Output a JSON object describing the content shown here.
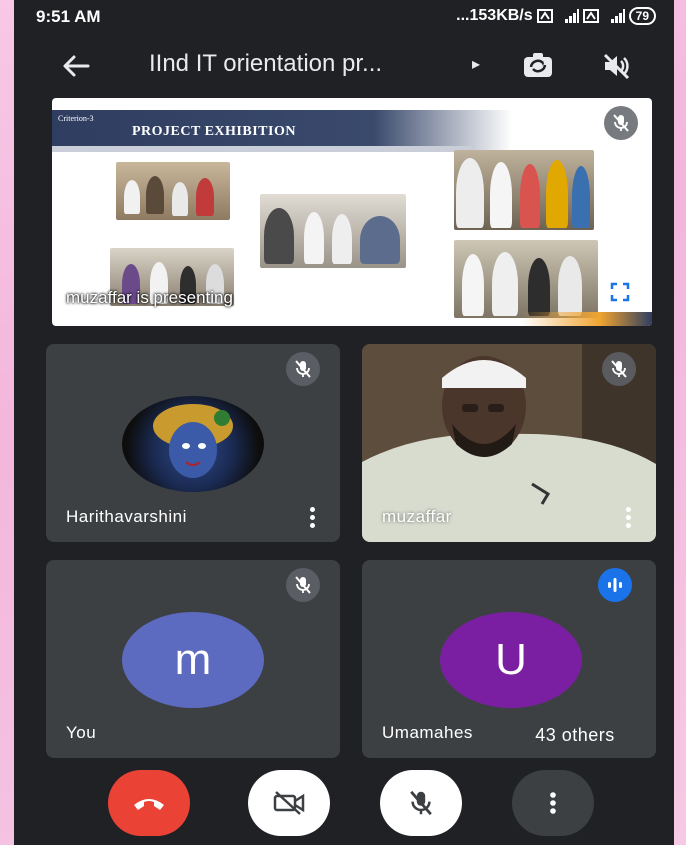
{
  "status": {
    "time": "9:51 AM",
    "network": "...153KB/s",
    "battery": "79",
    "icons": [
      "speed-icon",
      "signal-icon",
      "data-icon",
      "signal-icon"
    ]
  },
  "toolbar": {
    "title": "IInd IT orientation pr...",
    "title_arrow": "▸",
    "back_icon": "arrow-left-icon",
    "switch_icon": "switch-camera-icon",
    "audio_icon": "volume-off-icon"
  },
  "presentation": {
    "slide_criterion": "Criterion-3",
    "slide_title": "PROJECT EXHIBITION",
    "presenting_text": "muzaffar is presenting",
    "mic_icon": "mic-off-icon",
    "fullscreen_icon": "fullscreen-icon"
  },
  "participants": [
    {
      "name": "Harithavarshini",
      "muted": true,
      "avatar_type": "image"
    },
    {
      "name": "muzaffar",
      "muted": true,
      "avatar_type": "video"
    },
    {
      "name": "You",
      "muted": true,
      "avatar_type": "initial",
      "initial": "m",
      "color": "#5c6bc0"
    },
    {
      "name": "Umamahes",
      "muted": false,
      "speaking": true,
      "avatar_type": "initial",
      "initial": "U",
      "color": "#7b1fa2"
    }
  ],
  "others_label": "43 others",
  "controls": {
    "end_call_icon": "end-call-icon",
    "camera_icon": "camera-off-icon",
    "mic_icon": "mic-off-icon",
    "more_icon": "more-vertical-icon",
    "end_call_color": "#ea4335"
  }
}
